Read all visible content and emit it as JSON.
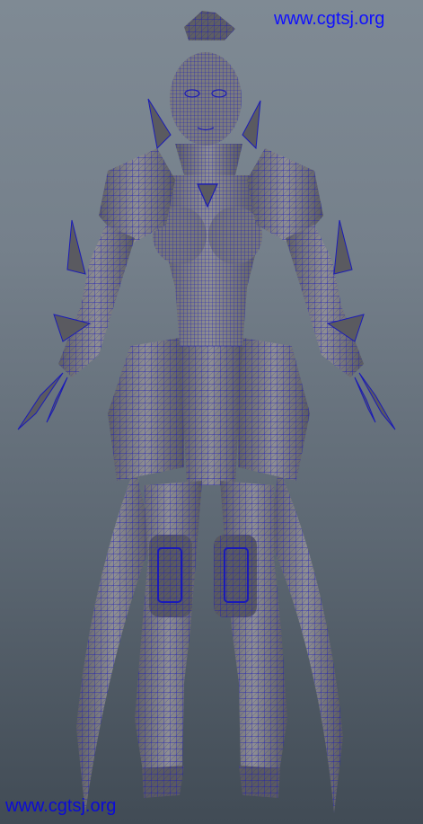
{
  "watermarks": {
    "top_right": "www.cgtsj.org",
    "bottom_left": "www.cgtsj.org"
  },
  "colors": {
    "background_top": "#7f8a94",
    "background_bottom": "#414b55",
    "mesh_fill": "#6e6e72",
    "mesh_fill_light": "#8a8a8e",
    "wireframe": "#1a1ab8",
    "watermark": "#1010ff"
  },
  "subject": "character-3d-wireframe-model"
}
